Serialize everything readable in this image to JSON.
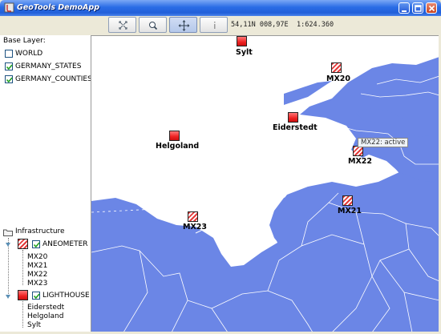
{
  "window": {
    "title": "GeoTools DemoApp",
    "minimize_icon": "minimize-icon",
    "maximize_icon": "maximize-icon",
    "close_icon": "close-icon"
  },
  "toolbar": {
    "buttons": [
      {
        "name": "zoom-extent",
        "icon": "zoom-extent-icon"
      },
      {
        "name": "zoom",
        "icon": "magnifier-icon"
      },
      {
        "name": "pan",
        "icon": "pan-arrows-icon",
        "active": true
      },
      {
        "name": "info",
        "icon": "info-icon"
      }
    ],
    "coords": "54,11N 008,97E",
    "scale": "1:624.360"
  },
  "base_layers": {
    "title": "Base Layer:",
    "items": [
      {
        "label": "WORLD",
        "checked": false
      },
      {
        "label": "GERMANY_STATES",
        "checked": true
      },
      {
        "label": "GERMANY_COUNTIES",
        "checked": true
      }
    ]
  },
  "infrastructure": {
    "title": "Infrastructure",
    "groups": [
      {
        "label": "ANEOMETER",
        "checked": true,
        "swatch": "hatched-red",
        "items": [
          "MX20",
          "MX21",
          "MX22",
          "MX23"
        ]
      },
      {
        "label": "LIGHTHOUSE",
        "checked": true,
        "swatch": "solid-red",
        "items": [
          "Eiderstedt",
          "Helgoland",
          "Sylt"
        ]
      }
    ]
  },
  "map": {
    "markers": [
      {
        "label": "Sylt",
        "type": "lighthouse"
      },
      {
        "label": "MX20",
        "type": "aneometer"
      },
      {
        "label": "Eiderstedt",
        "type": "lighthouse"
      },
      {
        "label": "Helgoland",
        "type": "lighthouse"
      },
      {
        "label": "MX22",
        "type": "aneometer"
      },
      {
        "label": "MX21",
        "type": "aneometer"
      },
      {
        "label": "MX23",
        "type": "aneometer"
      }
    ],
    "tooltip": "MX22: active",
    "colors": {
      "sea": "#6b86e6",
      "land": "#ffffff",
      "border": "#ffffff"
    }
  }
}
